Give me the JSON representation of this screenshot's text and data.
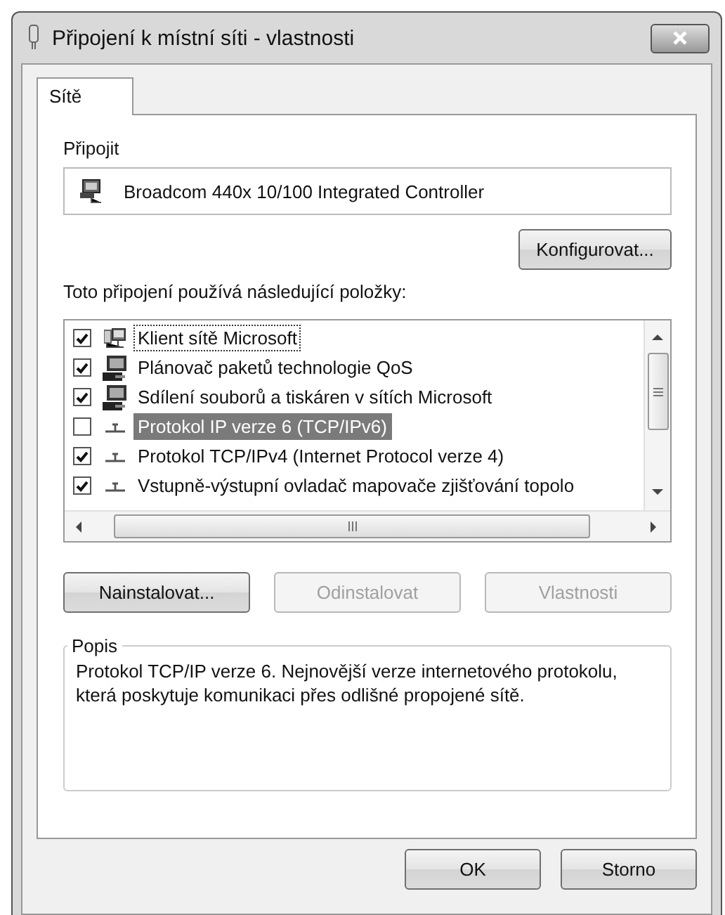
{
  "window": {
    "title": "Připojení k místní síti - vlastnosti"
  },
  "tabs": [
    {
      "label": "Sítě",
      "selected": true
    }
  ],
  "connect_using": {
    "label": "Připojit",
    "adapter": "Broadcom 440x 10/100 Integrated Controller",
    "configure_button": "Konfigurovat..."
  },
  "items_label": "Toto připojení používá následující položky:",
  "items": [
    {
      "label": "Klient sítě Microsoft",
      "kind": "client",
      "checked": true,
      "selected": false,
      "focused": true
    },
    {
      "label": "Plánovač paketů technologie QoS",
      "kind": "service",
      "checked": true,
      "selected": false,
      "focused": false
    },
    {
      "label": "Sdílení souborů a tiskáren v sítích Microsoft",
      "kind": "service",
      "checked": true,
      "selected": false,
      "focused": false
    },
    {
      "label": "Protokol IP verze 6 (TCP/IPv6)",
      "kind": "protocol",
      "checked": false,
      "selected": true,
      "focused": false
    },
    {
      "label": "Protokol TCP/IPv4 (Internet Protocol verze 4)",
      "kind": "protocol",
      "checked": true,
      "selected": false,
      "focused": false
    },
    {
      "label": "Vstupně-výstupní ovladač mapovače zjišťování topolo",
      "kind": "protocol",
      "checked": true,
      "selected": false,
      "focused": false
    }
  ],
  "item_buttons": [
    {
      "label": "Nainstalovat...",
      "disabled": false
    },
    {
      "label": "Odinstalovat",
      "disabled": true
    },
    {
      "label": "Vlastnosti",
      "disabled": true
    }
  ],
  "description": {
    "title": "Popis",
    "text": "Protokol TCP/IP verze 6. Nejnovější verze internetového protokolu, která poskytuje komunikaci přes odlišné propojené sítě."
  },
  "buttons": [
    {
      "label": "OK",
      "disabled": false
    },
    {
      "label": "Storno",
      "disabled": false
    }
  ]
}
